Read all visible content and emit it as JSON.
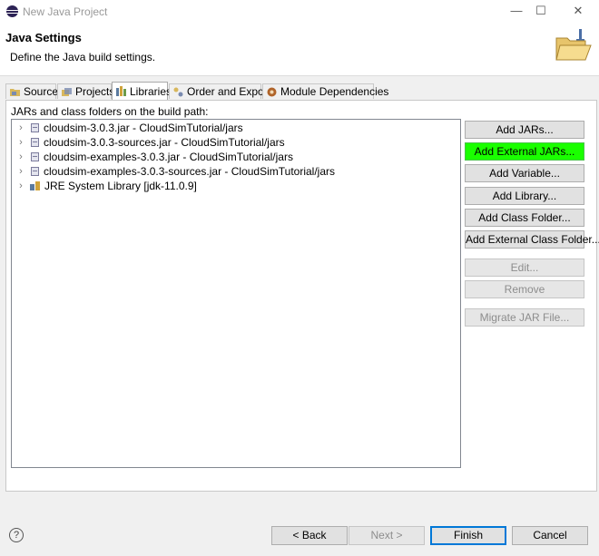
{
  "window": {
    "title": "New Java Project",
    "controls": {
      "minimize": "—",
      "maximize": "☐",
      "close": "✕"
    }
  },
  "header": {
    "title": "Java Settings",
    "description": "Define the Java build settings."
  },
  "tabs": [
    {
      "label": "Source",
      "icon": "source-folder-icon",
      "active": false
    },
    {
      "label": "Projects",
      "icon": "projects-icon",
      "active": false
    },
    {
      "label": "Libraries",
      "icon": "libraries-icon",
      "active": true
    },
    {
      "label": "Order and Export",
      "icon": "order-export-icon",
      "active": false
    },
    {
      "label": "Module Dependencies",
      "icon": "module-icon",
      "active": false
    }
  ],
  "libraries": {
    "label": "JARs and class folders on the build path:",
    "items": [
      {
        "label": "cloudsim-3.0.3.jar - CloudSimTutorial/jars",
        "icon": "jar-icon"
      },
      {
        "label": "cloudsim-3.0.3-sources.jar - CloudSimTutorial/jars",
        "icon": "jar-icon"
      },
      {
        "label": "cloudsim-examples-3.0.3.jar - CloudSimTutorial/jars",
        "icon": "jar-icon"
      },
      {
        "label": "cloudsim-examples-3.0.3-sources.jar - CloudSimTutorial/jars",
        "icon": "jar-icon"
      },
      {
        "label": "JRE System Library [jdk-11.0.9]",
        "icon": "library-icon"
      }
    ]
  },
  "side_buttons": {
    "add_jars": "Add JARs...",
    "add_external_jars": "Add External JARs...",
    "add_variable": "Add Variable...",
    "add_library": "Add Library...",
    "add_class_folder": "Add Class Folder...",
    "add_external_class_folder": "Add External Class Folder...",
    "edit": "Edit...",
    "remove": "Remove",
    "migrate_jar": "Migrate JAR File..."
  },
  "footer": {
    "help": "?",
    "back": "< Back",
    "next": "Next >",
    "finish": "Finish",
    "cancel": "Cancel"
  },
  "colors": {
    "highlight_button": "#1aff00",
    "default_button_border": "#0078d7"
  }
}
